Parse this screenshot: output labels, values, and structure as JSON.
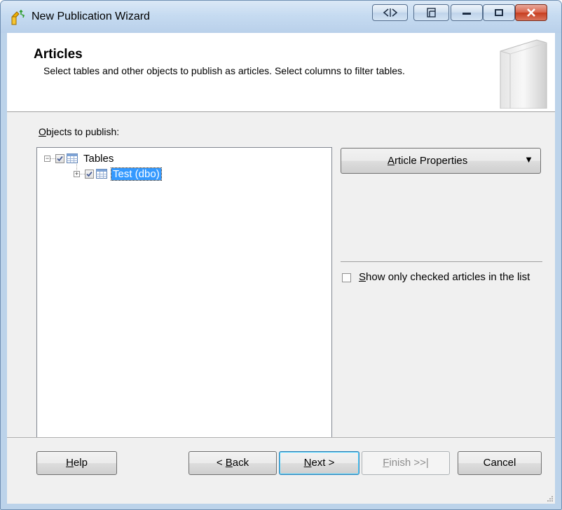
{
  "window": {
    "title": "New Publication Wizard"
  },
  "header": {
    "title": "Articles",
    "description": "Select tables and other objects to publish as articles. Select columns to filter tables."
  },
  "objects": {
    "label": "Objects to publish:",
    "tree": [
      {
        "label": "Tables",
        "checked": true,
        "expander": "−",
        "selected": false
      },
      {
        "label": "Test (dbo)",
        "checked": true,
        "expander": "+",
        "selected": true
      }
    ]
  },
  "article_properties": {
    "label": "Article Properties",
    "arrow": "▼"
  },
  "show_only_checked": {
    "label": "Show only checked articles in the list",
    "checked": false
  },
  "footer": {
    "help": "Help",
    "back": "< Back",
    "next": "Next >",
    "finish": "Finish >>|",
    "cancel": "Cancel"
  },
  "colors": {
    "selection": "#3399ff",
    "title_bar": "#c6dbf1",
    "close_button": "#c73e1f"
  }
}
